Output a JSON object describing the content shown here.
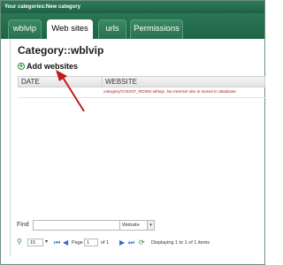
{
  "window": {
    "title": "Your categories:New category"
  },
  "tabs": [
    {
      "label": "wblvip"
    },
    {
      "label": "Web sites"
    },
    {
      "label": "urls"
    },
    {
      "label": "Permissions"
    }
  ],
  "page": {
    "title": "Category::wblvip",
    "add_websites": "Add websites"
  },
  "grid": {
    "columns": [
      "DATE",
      "WEBSITE"
    ],
    "rows": [
      {
        "date": "",
        "website": "category/COUNT_ROWS:wblvip ,No Internet site is stored in database"
      }
    ]
  },
  "find": {
    "label": "Find",
    "value": "",
    "field_option": "Website"
  },
  "pager": {
    "page_size": "15",
    "page_label": "Page",
    "page_value": "1",
    "of_label": "of 1",
    "status": "Displaying 1 to 1 of 1 items"
  },
  "colors": {
    "titlebar": "#1d6044",
    "error_text": "#b11a1a",
    "annotation_arrow": "#c21a1a"
  }
}
